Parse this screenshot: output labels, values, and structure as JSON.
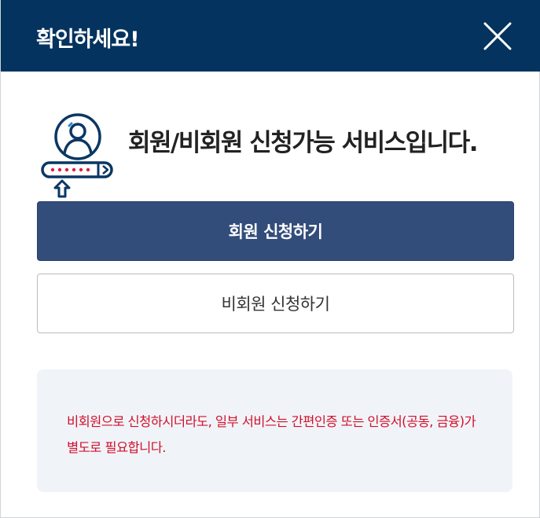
{
  "dialog": {
    "title": "확인하세요!",
    "close_icon": "close-icon"
  },
  "intro": {
    "icon": "user-password-login-icon",
    "message": "회원/비회원 신청가능 서비스입니다."
  },
  "buttons": {
    "member_label": "회원 신청하기",
    "nonmember_label": "비회원 신청하기"
  },
  "notice": {
    "text": "비회원으로 신청하시더라도, 일부 서비스는 간편인증 또는 인증서(공동, 금융)가 별도로 필요합니다."
  },
  "colors": {
    "header_bg": "#03335e",
    "primary_button": "#334d7b",
    "notice_bg": "#f0f4f8",
    "notice_text": "#d3102d"
  }
}
